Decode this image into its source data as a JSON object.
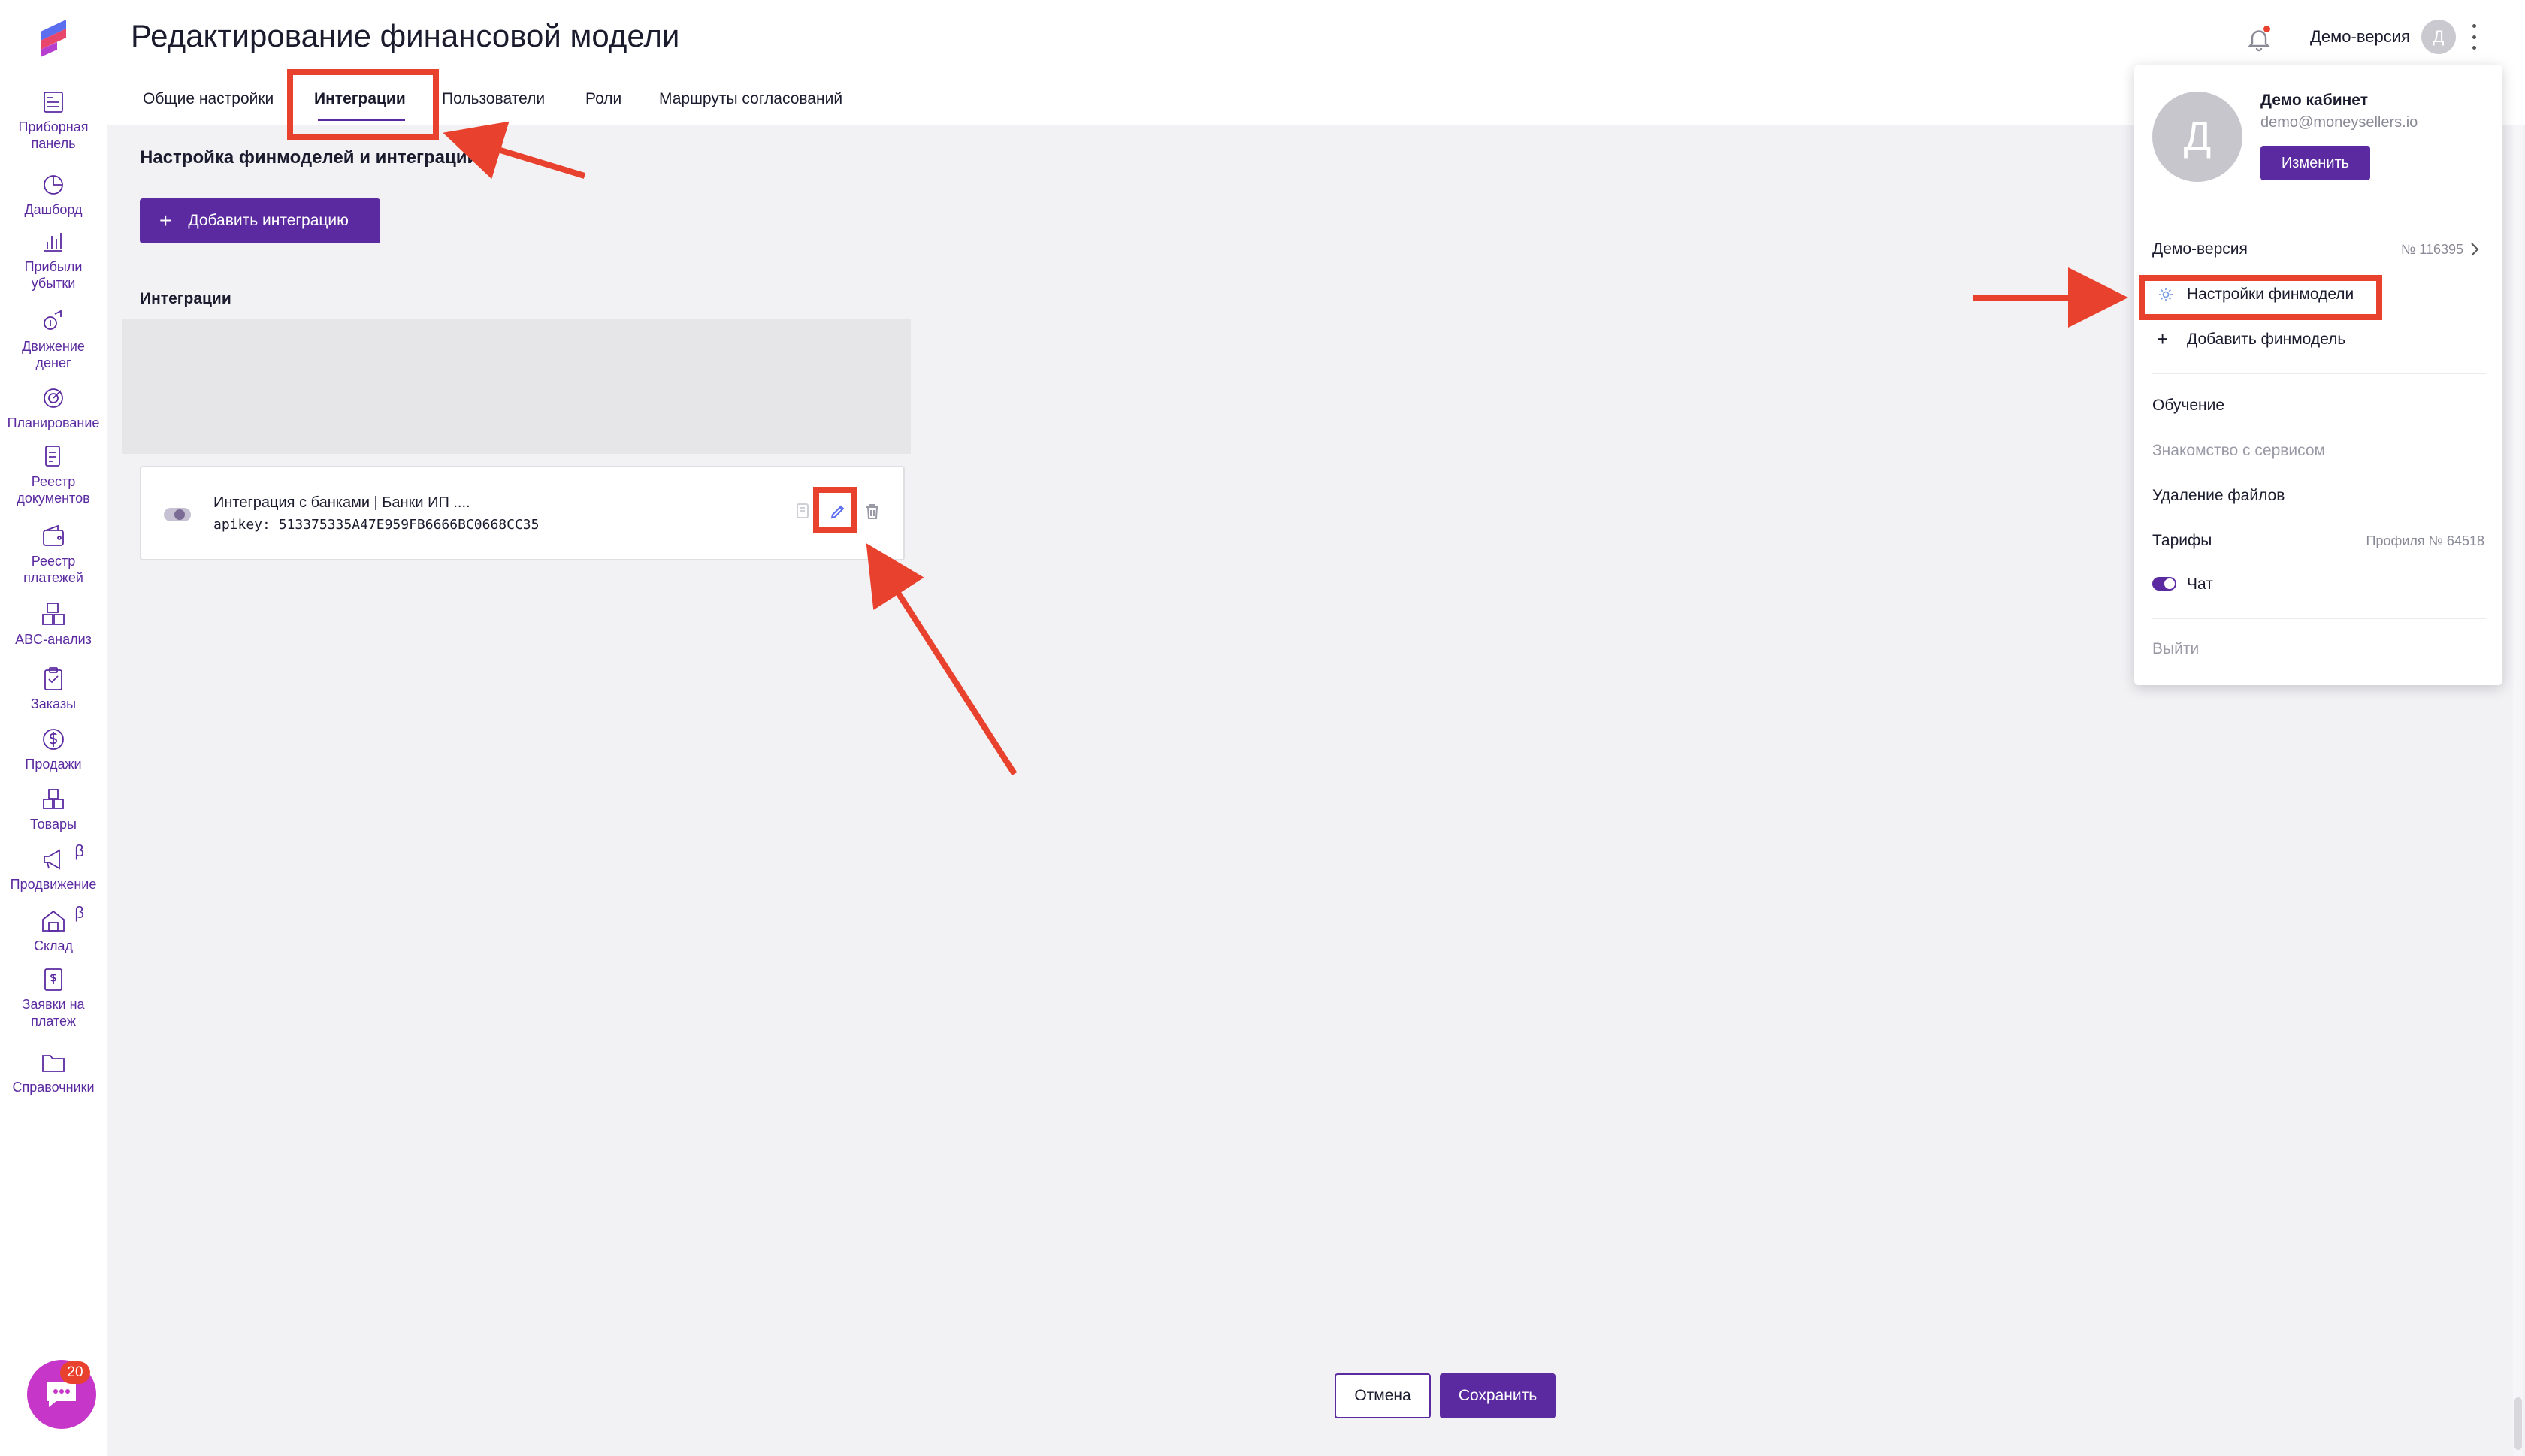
{
  "sidebar": {
    "items": [
      {
        "label": "Приборная\nпанель",
        "icon": "dashboard-icon"
      },
      {
        "label": "Дашборд",
        "icon": "pie-chart-icon"
      },
      {
        "label": "Прибыли\nубытки",
        "icon": "bar-chart-icon"
      },
      {
        "label": "Движение\nденег",
        "icon": "money-flow-icon"
      },
      {
        "label": "Планирование",
        "icon": "target-icon"
      },
      {
        "label": "Реестр\nдокументов",
        "icon": "documents-icon"
      },
      {
        "label": "Реестр\nплатежей",
        "icon": "wallet-icon"
      },
      {
        "label": "ABC-анализ",
        "icon": "abc-icon"
      },
      {
        "label": "Заказы",
        "icon": "clipboard-icon"
      },
      {
        "label": "Продажи",
        "icon": "dollar-icon"
      },
      {
        "label": "Товары",
        "icon": "boxes-icon"
      },
      {
        "label": "Продвижение",
        "icon": "megaphone-icon",
        "badge": "β"
      },
      {
        "label": "Склад",
        "icon": "warehouse-icon",
        "badge": "β"
      },
      {
        "label": "Заявки на\nплатеж",
        "icon": "payment-request-icon"
      },
      {
        "label": "Справочники",
        "icon": "folder-icon"
      }
    ]
  },
  "header": {
    "title": "Редактирование финансовой модели",
    "demo_label": "Демо-версия",
    "avatar_letter": "Д"
  },
  "tabs": [
    {
      "label": "Общие настройки"
    },
    {
      "label": "Интеграции",
      "active": true
    },
    {
      "label": "Пользователи"
    },
    {
      "label": "Роли"
    },
    {
      "label": "Маршруты согласований"
    }
  ],
  "main": {
    "section_title": "Настройка финмоделей и интеграций",
    "add_button": "Добавить интеграцию",
    "integrations_title": "Интеграции",
    "integration": {
      "name": "Интеграция с банками | Банки ИП ....",
      "apikey": "apikey: 513375335A47E959FB6666BC0668CC35",
      "enabled": false
    },
    "cancel": "Отмена",
    "save": "Сохранить"
  },
  "chat": {
    "badge": "20"
  },
  "dropdown": {
    "avatar_letter": "Д",
    "name": "Демо кабинет",
    "email": "demo@moneysellers.io",
    "edit": "Изменить",
    "demo": "Демо-версия",
    "demo_number": "№ 116395",
    "settings": "Настройки финмодели",
    "add_model": "Добавить финмодель",
    "learning": "Обучение",
    "intro": "Знакомство с сервисом",
    "delete_files": "Удаление файлов",
    "tariffs": "Тарифы",
    "profile_number": "Профиля № 64518",
    "chat": "Чат",
    "chat_enabled": true,
    "logout": "Выйти"
  },
  "colors": {
    "accent": "#5b2aa0",
    "annotation": "#e8422e",
    "chat_fab": "#c636c8"
  }
}
